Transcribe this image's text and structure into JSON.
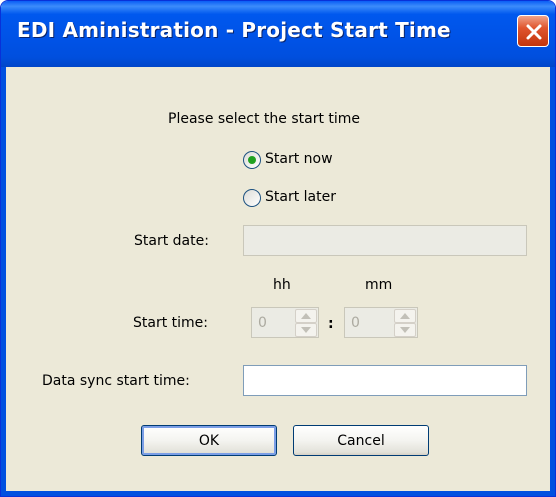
{
  "window": {
    "title": "EDI Aministration - Project Start Time"
  },
  "icons": {
    "close": "close-icon",
    "spin_up": "up-arrow-icon",
    "spin_down": "down-arrow-icon"
  },
  "colors": {
    "titlebar": "#0055e5",
    "close_button": "#e0552e",
    "dialog_background": "#ece9d8",
    "radio_selected_dot": "#21a121",
    "default_button_highlight": "#7b9ee6"
  },
  "form": {
    "prompt": "Please select the start time",
    "start_now": {
      "label": "Start now",
      "selected": true
    },
    "start_later": {
      "label": "Start later",
      "selected": false
    },
    "start_date": {
      "label": "Start date:",
      "value": "",
      "disabled": true
    },
    "start_time": {
      "label": "Start time:",
      "hh_label": "hh",
      "mm_label": "mm",
      "separator": ":",
      "hh_value": "0",
      "mm_value": "0",
      "disabled": true
    },
    "data_sync": {
      "label": "Data sync start time:",
      "value": ""
    }
  },
  "buttons": {
    "ok": "OK",
    "cancel": "Cancel"
  }
}
